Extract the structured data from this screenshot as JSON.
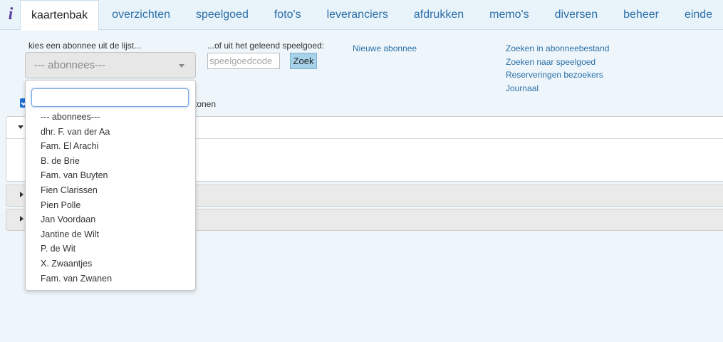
{
  "nav": {
    "logo": "i",
    "tabs": [
      {
        "label": "kaartenbak",
        "active": true
      },
      {
        "label": "overzichten"
      },
      {
        "label": "speelgoed"
      },
      {
        "label": "foto's"
      },
      {
        "label": "leveranciers"
      },
      {
        "label": "afdrukken"
      },
      {
        "label": "memo's"
      },
      {
        "label": "diversen"
      },
      {
        "label": "beheer"
      },
      {
        "label": "einde"
      }
    ]
  },
  "form": {
    "choose_label": "kies een abonnee uit de lijst...",
    "select_value": "--- abonnees---",
    "borrowed_label": "...of uit het geleend speelgoed:",
    "code_placeholder": "speelgoedcode",
    "search_button": "Zoek",
    "checkbox_label": "tonen",
    "checkbox_checked": true
  },
  "links": {
    "new_subscriber": "Nieuwe abonnee",
    "search_subscribers": "Zoeken in abonneebestand",
    "search_toys": "Zoeken naar speelgoed",
    "visitor_reservations": "Reserveringen bezoekers",
    "journal": "Journaal"
  },
  "dropdown": {
    "search_value": "",
    "options": [
      "--- abonnees---",
      "dhr. F. van der Aa",
      "Fam. El Arachi",
      "B. de Brie",
      "Fam. van Buyten",
      "Fien Clarissen",
      "Pien Polle",
      "Jan Voordaan",
      "Jantine de Wilt",
      "P. de Wit",
      "X. Zwaantjes",
      "Fam. van Zwanen"
    ]
  },
  "colors": {
    "background": "#eef6fb",
    "link": "#2a6fa8",
    "button": "#a7d3ea",
    "checkbox": "#1e6fd6"
  }
}
